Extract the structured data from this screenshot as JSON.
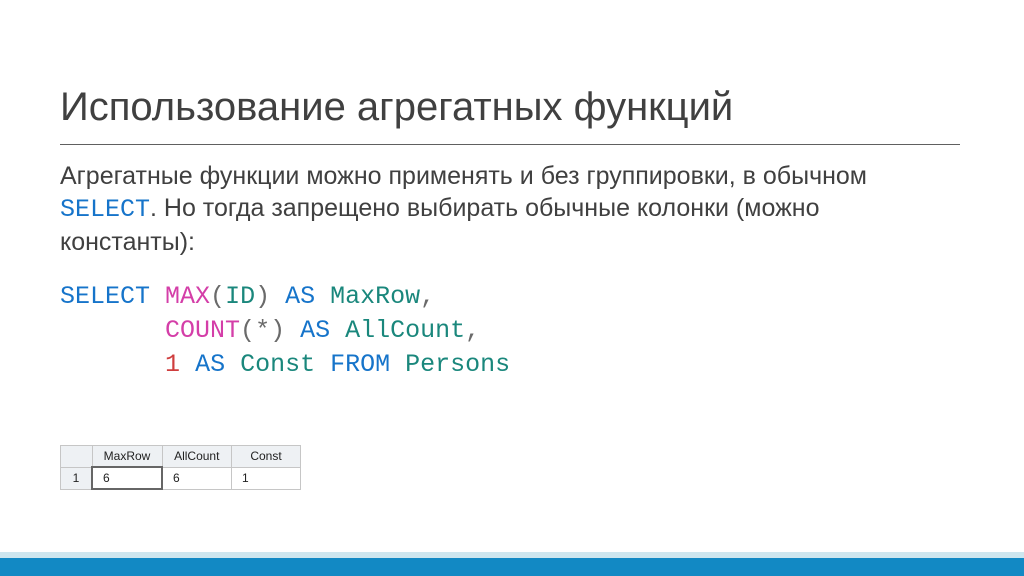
{
  "title": "Использование агрегатных функций",
  "body": {
    "pre": "Агрегатные функции можно применять и без группировки, в обычном ",
    "select_kw": "SELECT",
    "post": ". Но тогда запрещено выбирать обычные колонки (можно константы):"
  },
  "sql": {
    "kw_select": "SELECT",
    "fn_max": "MAX",
    "lp1": "(",
    "id_id": "ID",
    "rp1": ")",
    "kw_as1": "AS",
    "alias_maxrow": "MaxRow",
    "comma1": ",",
    "pad2": "       ",
    "fn_count": "COUNT",
    "lp2": "(",
    "star": "*",
    "rp2": ")",
    "kw_as2": "AS",
    "alias_allcount": "AllCount",
    "comma2": ",",
    "pad3": "       ",
    "num_1": "1",
    "kw_as3": "AS",
    "alias_const": "Const",
    "kw_from": "FROM",
    "tbl": "Persons"
  },
  "result": {
    "headers": [
      "MaxRow",
      "AllCount",
      "Const"
    ],
    "rownum": "1",
    "row": [
      "6",
      "6",
      "1"
    ]
  },
  "chart_data": {
    "type": "table",
    "title": "Query result",
    "columns": [
      "MaxRow",
      "AllCount",
      "Const"
    ],
    "rows": [
      [
        "6",
        "6",
        "1"
      ]
    ]
  },
  "colors": {
    "accent": "#1289c4",
    "keyword": "#1674ca",
    "func": "#d43ea8",
    "ident": "#1a877c",
    "number": "#cf3e3e"
  }
}
